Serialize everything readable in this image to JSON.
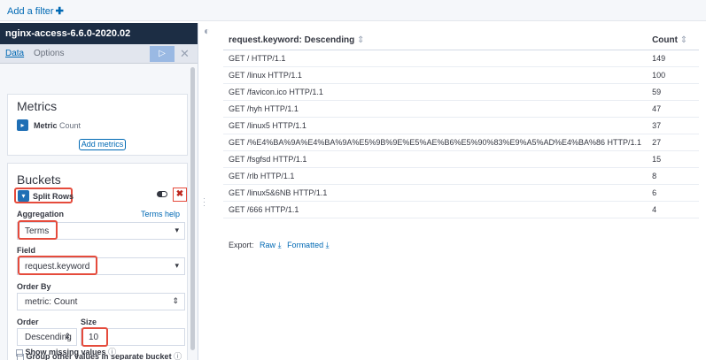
{
  "filterbar": {
    "add_filter": "Add a filter",
    "add_icon": "plus-icon"
  },
  "sidebar": {
    "index_pattern": "nginx-access-6.6.0-2020.02",
    "tabs": [
      {
        "label": "Data"
      },
      {
        "label": "Options"
      }
    ],
    "apply_icon": "play-icon",
    "close_icon": "close-icon",
    "metrics": {
      "title": "Metrics",
      "item_name": "Metric",
      "item_value": "Count",
      "add_button": "Add metrics"
    },
    "buckets": {
      "title": "Buckets",
      "split_label": "Split Rows",
      "aggregation_label": "Aggregation",
      "terms_help": "Terms help",
      "aggregation_value": "Terms",
      "field_label": "Field",
      "field_value": "request.keyword",
      "order_by_label": "Order By",
      "order_by_value": "metric: Count",
      "order_label": "Order",
      "order_value": "Descending",
      "size_label": "Size",
      "size_value": "10",
      "group_other": "Group other values in separate bucket",
      "show_missing": "Show missing values"
    }
  },
  "table": {
    "columns": [
      "request.keyword: Descending",
      "Count"
    ],
    "rows": [
      {
        "key": "GET / HTTP/1.1",
        "count": "149"
      },
      {
        "key": "GET /linux HTTP/1.1",
        "count": "100"
      },
      {
        "key": "GET /favicon.ico HTTP/1.1",
        "count": "59"
      },
      {
        "key": "GET /hyh HTTP/1.1",
        "count": "47"
      },
      {
        "key": "GET /linux5 HTTP/1.1",
        "count": "37"
      },
      {
        "key": "GET /%E4%BA%9A%E4%BA%9A%E5%9B%9E%E5%AE%B6%E5%90%83%E9%A5%AD%E4%BA%86 HTTP/1.1",
        "count": "27"
      },
      {
        "key": "GET /fsgfsd HTTP/1.1",
        "count": "15"
      },
      {
        "key": "GET /rlb HTTP/1.1",
        "count": "8"
      },
      {
        "key": "GET /linux5&6NB HTTP/1.1",
        "count": "6"
      },
      {
        "key": "GET /666 HTTP/1.1",
        "count": "4"
      }
    ],
    "export_label": "Export:",
    "export_raw": "Raw",
    "export_formatted": "Formatted"
  },
  "colors": {
    "accent": "#0069b4",
    "header_bg": "#1c2d44",
    "highlight": "#e54b3c"
  }
}
